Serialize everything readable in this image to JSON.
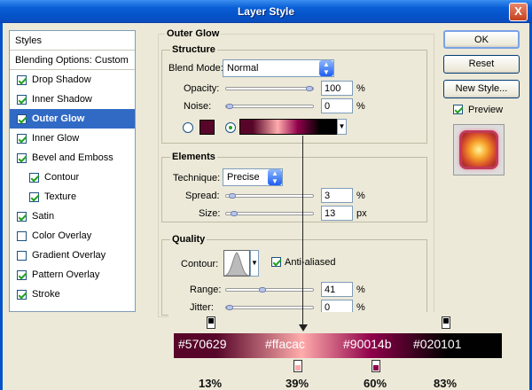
{
  "window": {
    "title": "Layer Style",
    "close_glyph": "X"
  },
  "styles_panel": {
    "header": "Styles",
    "blending_options": "Blending Options: Custom",
    "items": [
      {
        "label": "Drop Shadow",
        "checked": true
      },
      {
        "label": "Inner Shadow",
        "checked": true
      },
      {
        "label": "Outer Glow",
        "checked": true,
        "selected": true
      },
      {
        "label": "Inner Glow",
        "checked": true
      },
      {
        "label": "Bevel and Emboss",
        "checked": true
      },
      {
        "label": "Contour",
        "checked": true,
        "indent": true
      },
      {
        "label": "Texture",
        "checked": true,
        "indent": true
      },
      {
        "label": "Satin",
        "checked": true
      },
      {
        "label": "Color Overlay",
        "checked": false
      },
      {
        "label": "Gradient Overlay",
        "checked": false
      },
      {
        "label": "Pattern Overlay",
        "checked": true
      },
      {
        "label": "Stroke",
        "checked": true
      }
    ]
  },
  "outer_glow": {
    "title": "Outer Glow",
    "structure": {
      "title": "Structure",
      "blend_mode_label": "Blend Mode:",
      "blend_mode_value": "Normal",
      "opacity_label": "Opacity:",
      "opacity_value": "100",
      "opacity_fraction": 1.0,
      "noise_label": "Noise:",
      "noise_value": "0",
      "noise_fraction": 0.0,
      "unit_percent": "%",
      "swatch_color": "#570629"
    },
    "elements": {
      "title": "Elements",
      "technique_label": "Technique:",
      "technique_value": "Precise",
      "spread_label": "Spread:",
      "spread_value": "3",
      "spread_fraction": 0.03,
      "size_label": "Size:",
      "size_value": "13",
      "size_fraction": 0.05,
      "unit_px": "px"
    },
    "quality": {
      "title": "Quality",
      "contour_label": "Contour:",
      "anti_aliased_label": "Anti-aliased",
      "anti_aliased_checked": true,
      "range_label": "Range:",
      "range_value": "41",
      "range_fraction": 0.41,
      "jitter_label": "Jitter:",
      "jitter_value": "0",
      "jitter_fraction": 0.0
    }
  },
  "buttons": {
    "ok": "OK",
    "reset": "Reset",
    "new_style": "New Style...",
    "preview": "Preview",
    "preview_checked": true
  },
  "gradient": {
    "stops": [
      {
        "color": "#570629",
        "label": "#570629",
        "percent": "13%"
      },
      {
        "color": "#ffacac",
        "label": "#ffacac",
        "percent": "39%"
      },
      {
        "color": "#90014b",
        "label": "#90014b",
        "percent": "60%"
      },
      {
        "color": "#020101",
        "label": "#020101",
        "percent": "83%"
      }
    ]
  }
}
